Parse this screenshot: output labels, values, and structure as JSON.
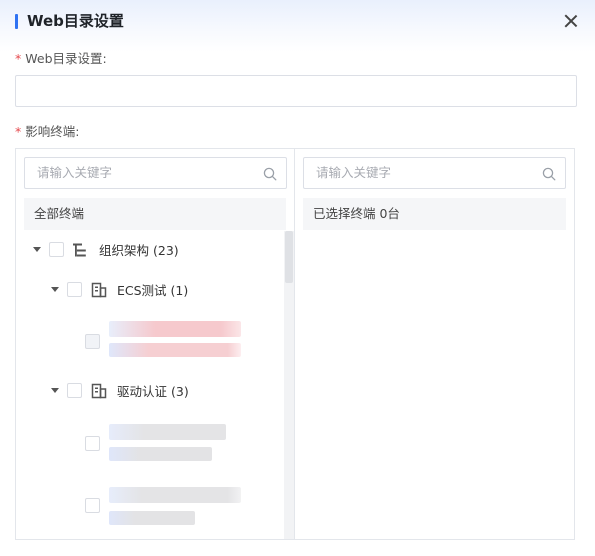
{
  "dialog": {
    "title": "Web目录设置",
    "close_icon": "close-icon"
  },
  "form": {
    "web_dir_label": "Web目录设置:",
    "web_dir_value": "",
    "terminals_label": "影响终端:",
    "required_mark": "*"
  },
  "left_panel": {
    "search_placeholder": "请输入关键字",
    "header": "全部终端",
    "tree": {
      "root": {
        "label": "组织架构",
        "count": "(23)",
        "icon": "org-tree-icon"
      },
      "groups": [
        {
          "label": "ECS测试",
          "count": "(1)",
          "icon": "building-icon"
        },
        {
          "label": "驱动认证",
          "count": "(3)",
          "icon": "building-icon"
        }
      ]
    }
  },
  "right_panel": {
    "search_placeholder": "请输入关键字",
    "header": "已选择终端 0台"
  },
  "colors": {
    "accent": "#2f72f2",
    "required": "#e5484d"
  }
}
